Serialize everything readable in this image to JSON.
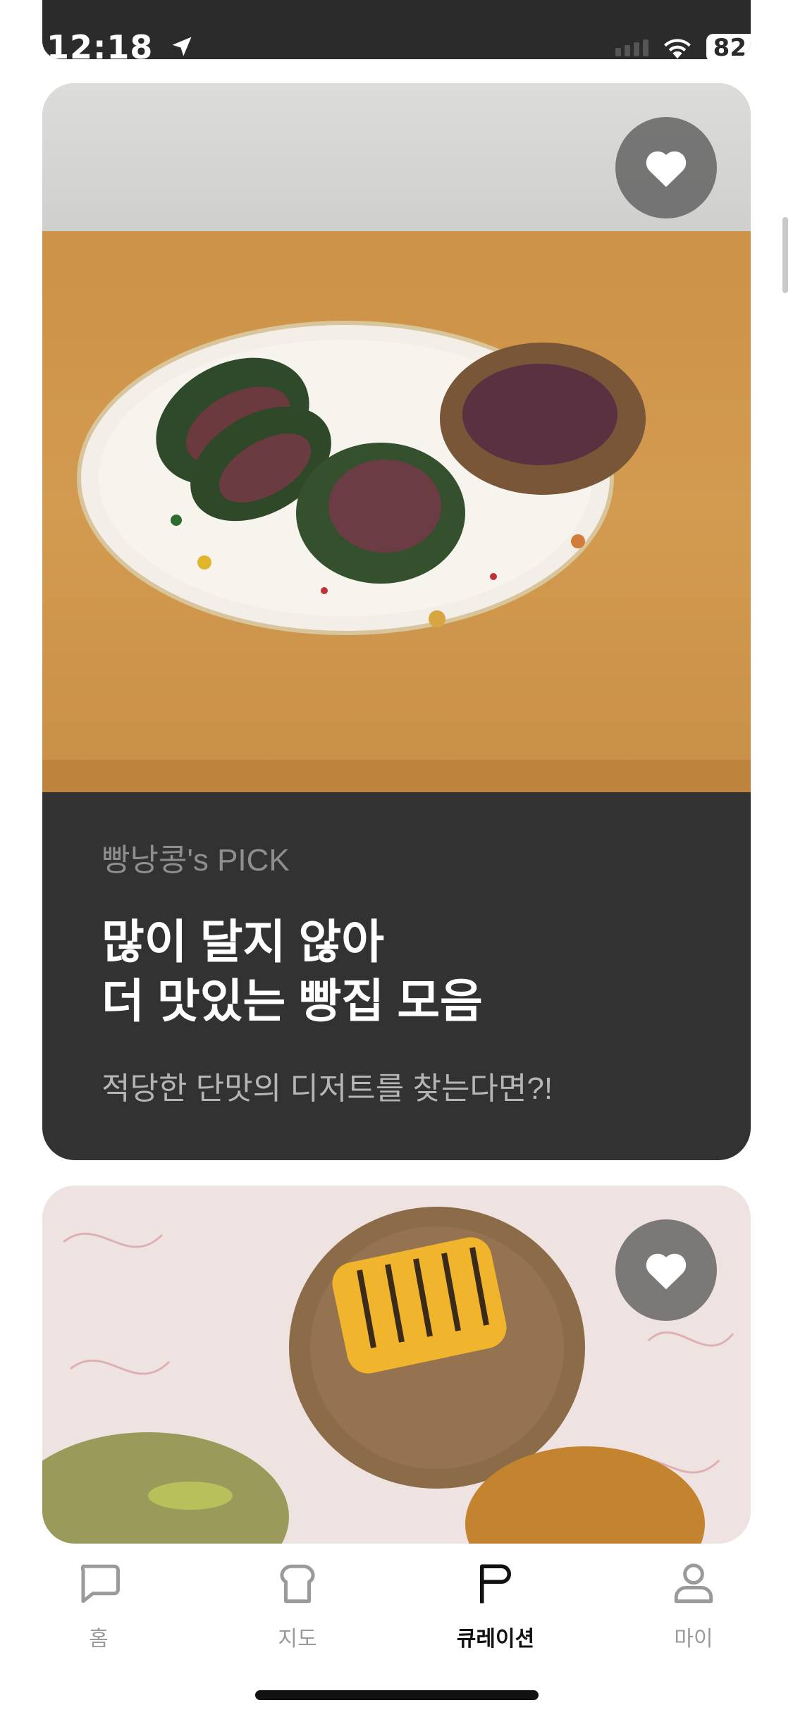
{
  "status_bar": {
    "time": "12:18",
    "battery": "82"
  },
  "cards": [
    {
      "label": "빵낭콩's PICK",
      "title_line1": "많이 달지 않아",
      "title_line2": "더 맛있는 빵집 모음",
      "subtitle": "적당한 단맛의 디저트를 찾는다면?!"
    }
  ],
  "tabs": [
    {
      "label": "홈",
      "icon": "speech-bubble-icon"
    },
    {
      "label": "지도",
      "icon": "bread-icon"
    },
    {
      "label": "큐레이션",
      "icon": "flag-icon",
      "active": true
    },
    {
      "label": "마이",
      "icon": "person-icon"
    }
  ],
  "colors": {
    "card_bg": "#323232",
    "active_tab": "#111111",
    "inactive_tab": "#9a9a9a"
  }
}
